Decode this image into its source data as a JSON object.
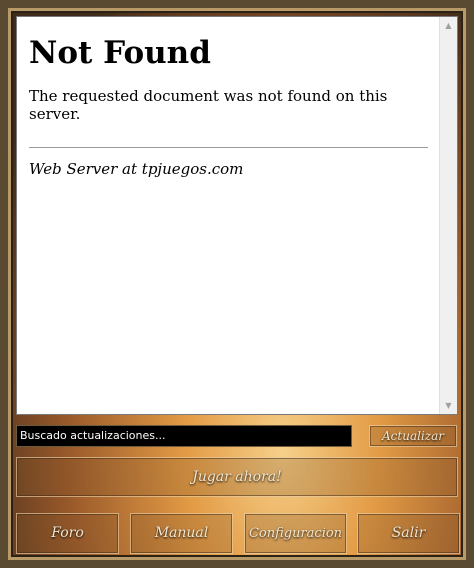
{
  "page": {
    "heading": "Not Found",
    "message": "The requested document was not found on this server.",
    "server_signature": "Web Server at tpjuegos.com"
  },
  "scrollbar": {
    "up_icon": "scroll-up-arrow-icon",
    "down_icon": "scroll-down-arrow-icon"
  },
  "status": {
    "text": "Buscado actualizaciones..."
  },
  "buttons": {
    "update": "Actualizar",
    "play": "Jugar ahora!",
    "foro": "Foro",
    "manual": "Manual",
    "config": "Configuracion",
    "salir": "Salir"
  },
  "colors": {
    "frame": "#5b4a32",
    "status_bg": "#000000",
    "button_text": "#f2e6cf"
  }
}
